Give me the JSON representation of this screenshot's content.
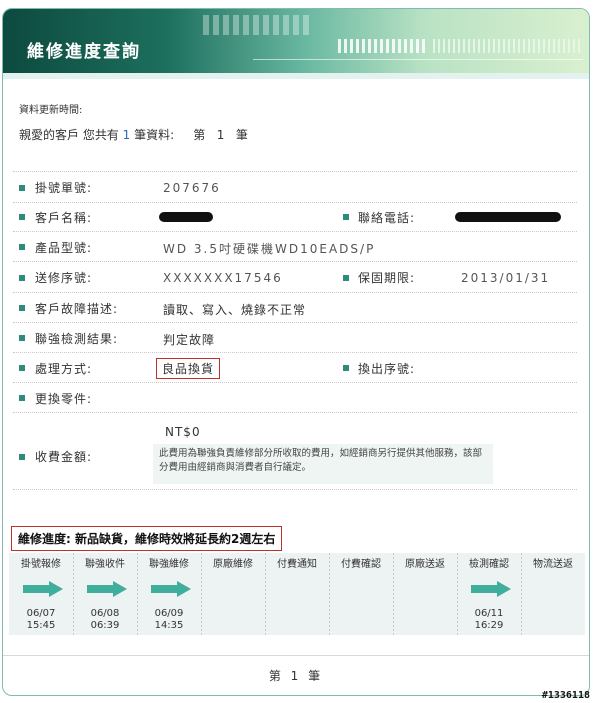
{
  "banner": {
    "title": "維修進度查詢"
  },
  "meta": {
    "updated_label": "資料更新時間:",
    "summary_prefix": "親愛的客戶 您共有",
    "record_count": "1",
    "summary_suffix": "筆資料:",
    "page_prefix": "第",
    "page_number": "1",
    "page_suffix": "筆"
  },
  "details": {
    "ticket_label": "掛號單號:",
    "ticket_value": "207676",
    "customer_label": "客戶名稱:",
    "phone_label": "聯絡電話:",
    "model_label": "產品型號:",
    "model_value": "WD 3.5吋硬碟機WD10EADS/P",
    "serial_label": "送修序號:",
    "serial_value": "XXXXXXX17546",
    "warranty_label": "保固期限:",
    "warranty_value": "2013/01/31",
    "fault_label": "客戶故障描述:",
    "fault_value": "讀取、寫入、燒錄不正常",
    "test_label": "聯強檢測結果:",
    "test_value": "判定故障",
    "handling_label": "處理方式:",
    "handling_value": "良品換貨",
    "replacement_serial_label": "換出序號:",
    "parts_label": "更換零件:",
    "fee_label": "收費金額:",
    "fee_value": "NT$0",
    "fee_note": "此費用為聯強負責維修部分所收取的費用，如經銷商另行提供其他服務，該部分費用由經銷商與消費者自行議定。"
  },
  "progress": {
    "heading_label": "維修進度:",
    "heading_status": "新品缺貨，維修時效將延長約2週左右",
    "steps": [
      {
        "label": "掛號報修",
        "done": true,
        "date": "06/07",
        "time": "15:45"
      },
      {
        "label": "聯強收件",
        "done": true,
        "date": "06/08",
        "time": "06:39"
      },
      {
        "label": "聯強維修",
        "done": true,
        "date": "06/09",
        "time": "14:35"
      },
      {
        "label": "原廠維修",
        "done": false,
        "date": "",
        "time": ""
      },
      {
        "label": "付費通知",
        "done": false,
        "date": "",
        "time": ""
      },
      {
        "label": "付費確認",
        "done": false,
        "date": "",
        "time": ""
      },
      {
        "label": "原廠送返",
        "done": false,
        "date": "",
        "time": ""
      },
      {
        "label": "檢測確認",
        "done": true,
        "date": "06/11",
        "time": "16:29"
      },
      {
        "label": "物流送返",
        "done": false,
        "date": "",
        "time": ""
      }
    ]
  },
  "footer": {
    "page_text": "第 1 筆"
  },
  "watermark": "#1336118",
  "colors": {
    "accent": "#2e8c7e",
    "highlight_border": "#c0302a",
    "arrow": "#3fae9c",
    "link_number": "#2a6fb5"
  }
}
